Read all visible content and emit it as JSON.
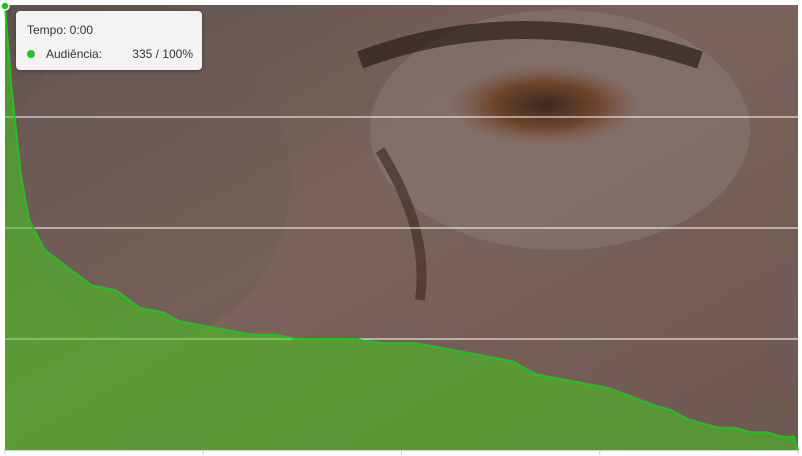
{
  "tooltip": {
    "title": "Tempo: 0:00",
    "series_label": "Audiência:",
    "value": "335 / 100%"
  },
  "chart_data": {
    "type": "area",
    "title": "",
    "xlabel": "",
    "ylabel": "",
    "ylim": [
      0,
      100
    ],
    "grid": true,
    "series": [
      {
        "name": "Audiência",
        "color": "#1ec41e",
        "x": [
          0,
          0.8,
          2,
          3,
          5,
          8,
          11,
          14,
          17,
          20,
          22,
          25,
          28,
          31,
          34,
          37,
          40,
          44,
          48,
          52,
          55,
          58,
          61,
          64,
          67,
          70,
          73,
          76,
          79,
          82,
          84,
          86,
          88,
          90,
          92,
          94,
          96,
          98,
          99.5,
          100
        ],
        "values": [
          100,
          82,
          62,
          52,
          45,
          41,
          37,
          36,
          32,
          31,
          29,
          28,
          27,
          26,
          26,
          25,
          25,
          25,
          24,
          24,
          23,
          22,
          21,
          20,
          17,
          16,
          15,
          14,
          12,
          10,
          9,
          7,
          6,
          5,
          5,
          4,
          4,
          3,
          3,
          0
        ]
      }
    ]
  },
  "colors": {
    "line": "#1ec41e",
    "fill": "rgba(70,200,30,0.55)",
    "grid": "#ffffff",
    "axis": "#cccccc"
  }
}
